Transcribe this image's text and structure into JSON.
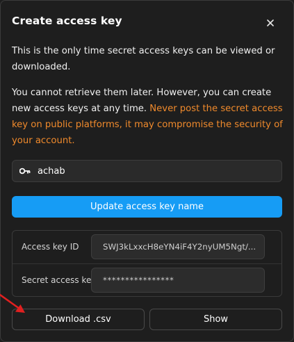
{
  "dialog": {
    "title": "Create access key",
    "close_icon": "close-icon",
    "info_text": "This is the only time secret access keys can be viewed or downloaded.",
    "retrieve_text": "You cannot retrieve them later. However, you can create new access keys at any time. ",
    "warning_text": "Never post the secret access key on public platforms, it may compromise the security of your account.",
    "warning_color": "#f08a2c"
  },
  "name_field": {
    "icon": "key-icon",
    "value": "achab"
  },
  "update_button": {
    "label": "Update access key name",
    "color": "#169cf5"
  },
  "keys": {
    "id_label": "Access key ID",
    "id_value": "SWJ3kLxxcH8eYN4iF4Y2nyUM5Ngt/...",
    "secret_label": "Secret access key",
    "secret_value": "****************"
  },
  "actions": {
    "download_label": "Download .csv",
    "show_label": "Show"
  },
  "annotation": {
    "arrow_color": "#e02020"
  }
}
